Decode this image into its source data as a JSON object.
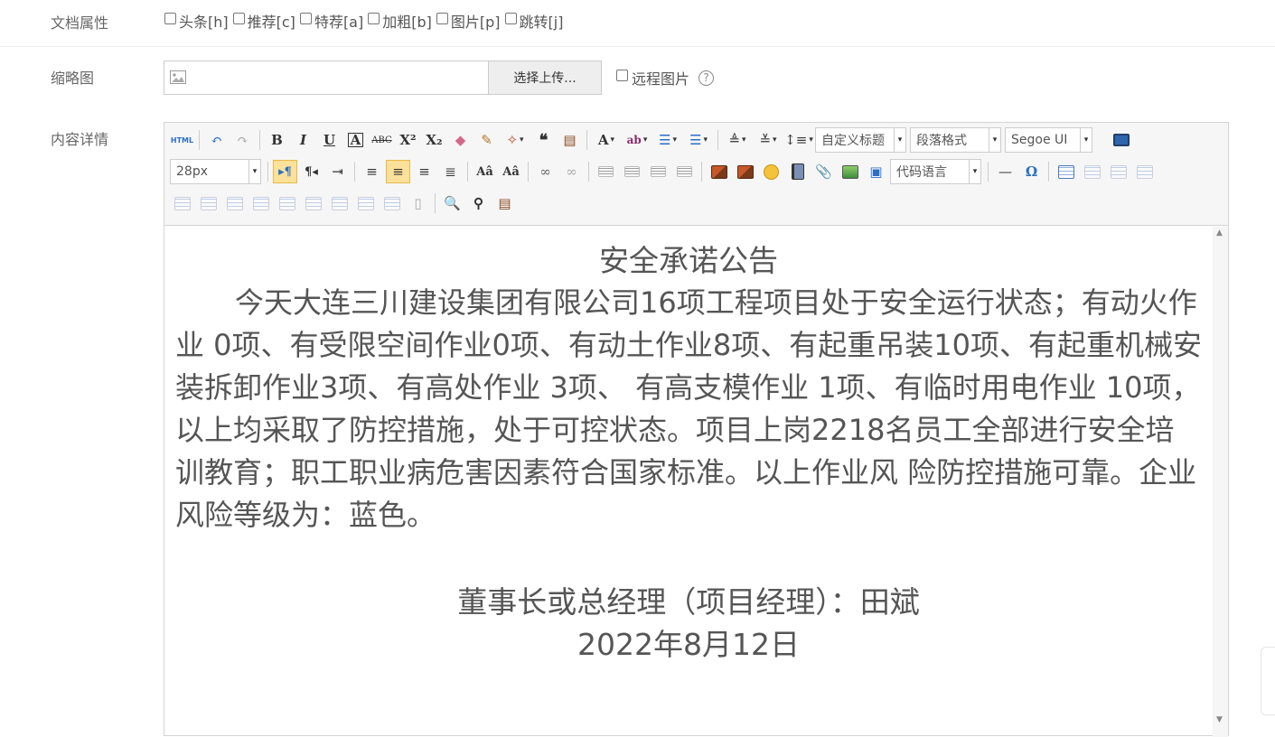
{
  "attrs": {
    "label": "文档属性",
    "options": [
      {
        "label": "头条[h]",
        "checked": false
      },
      {
        "label": "推荐[c]",
        "checked": false
      },
      {
        "label": "特荐[a]",
        "checked": false
      },
      {
        "label": "加粗[b]",
        "checked": false
      },
      {
        "label": "图片[p]",
        "checked": false
      },
      {
        "label": "跳转[j]",
        "checked": false
      }
    ]
  },
  "thumbnail": {
    "label": "缩略图",
    "upload_label": "选择上传...",
    "remote_label": "远程图片",
    "help_icon": "?"
  },
  "content": {
    "label": "内容详情",
    "toolbar": {
      "html_label": "HTML",
      "heading_select": "自定义标题",
      "paragraph_select": "段落格式",
      "font_select": "Segoe UI",
      "size_select": "28px",
      "code_select": "代码语言",
      "omega_label": "Ω"
    },
    "document": {
      "title": "安全承诺公告",
      "body": "今天大连三川建设集团有限公司16项工程项目处于安全运行状态；有动火作业 0项、有受限空间作业0项、有动土作业8项、有起重吊装10项、有起重机械安装拆卸作业3项、有高处作业 3项、 有高支模作业 1项、有临时用电作业 10项，以上均采取了防控措施，处于可控状态。项目上岗2218名员工全部进行安全培训教育；职工职业病危害因素符合国家标准。以上作业风 险防控措施可靠。企业风险等级为：蓝色。",
      "signature": "董事长或总经理（项目经理）：田斌",
      "date": "2022年8月12日"
    }
  }
}
